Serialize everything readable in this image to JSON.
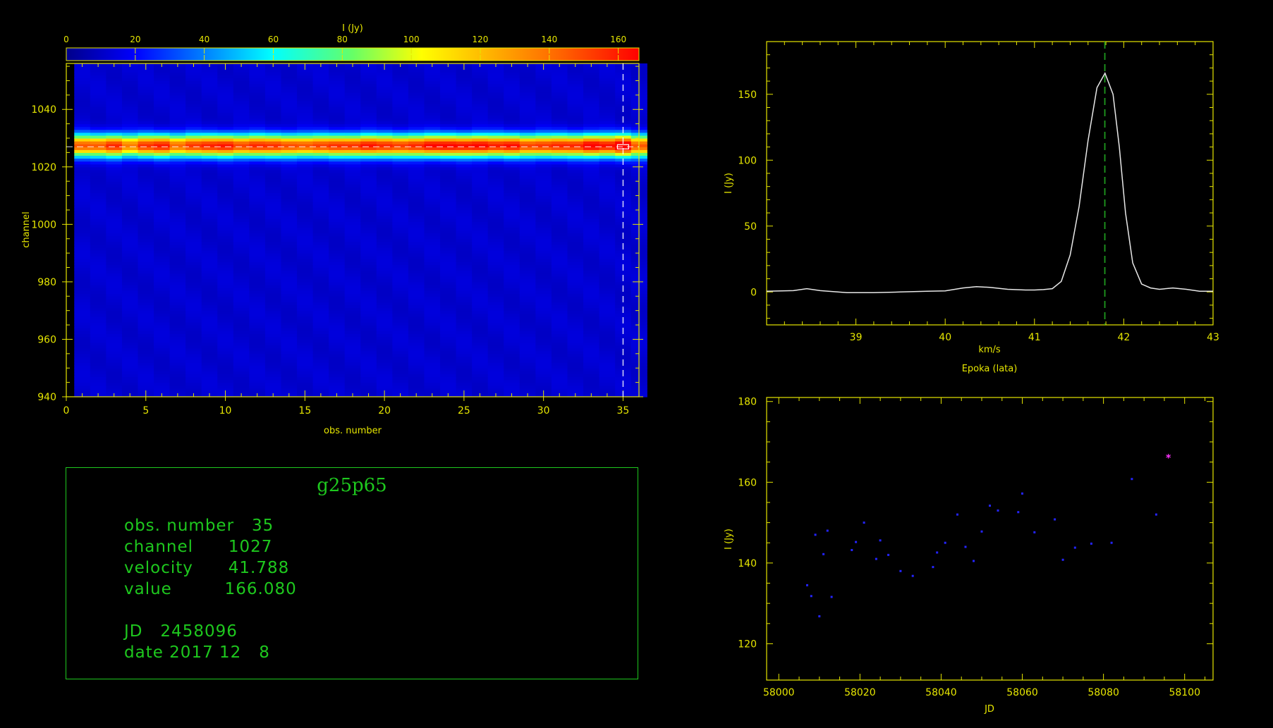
{
  "colors": {
    "axis": "#e6e600",
    "text": "#e6e600",
    "info": "#1ec81e",
    "spectrum": "#e8e8e8",
    "cursor_line": "#1e9a1e",
    "points": "#2424ff",
    "current_point": "#ff33ff",
    "background": "#000000"
  },
  "colorbar": {
    "label": "I (Jy)",
    "ticks": [
      "0",
      "20",
      "40",
      "60",
      "80",
      "100",
      "120",
      "140",
      "160"
    ],
    "range": [
      0,
      166
    ]
  },
  "waterfall": {
    "xlabel": "obs. number",
    "ylabel": "channel",
    "x_ticks": [
      "0",
      "5",
      "10",
      "15",
      "20",
      "25",
      "30",
      "35"
    ],
    "y_ticks": [
      "940",
      "960",
      "980",
      "1000",
      "1020",
      "1040"
    ],
    "xlim": [
      0,
      36
    ],
    "ylim": [
      940,
      1056
    ],
    "selected_obs": 35,
    "selected_channel": 1027,
    "n_obs": 36,
    "peak_channel": 1027
  },
  "info": {
    "title": "g25p65",
    "line1": "obs. number   35",
    "line2": "channel      1027",
    "line3": "velocity      41.788",
    "line4": "value         166.080",
    "line5": "JD   2458096",
    "line6": "date 2017 12   8"
  },
  "spectrum_chart": {
    "type": "line",
    "xlabel": "km/s",
    "ylabel": "I (Jy)",
    "footer": "Epoka (lata)",
    "x_ticks": [
      "39",
      "40",
      "41",
      "42",
      "43"
    ],
    "y_ticks": [
      "0",
      "50",
      "100",
      "150"
    ],
    "xlim": [
      38.0,
      43.0
    ],
    "ylim": [
      -25,
      190
    ],
    "cursor_velocity": 41.788,
    "points": [
      [
        38.0,
        0.5
      ],
      [
        38.3,
        1.0
      ],
      [
        38.45,
        2.5
      ],
      [
        38.6,
        1.0
      ],
      [
        38.9,
        -0.5
      ],
      [
        39.2,
        -0.5
      ],
      [
        39.5,
        0
      ],
      [
        39.8,
        0.5
      ],
      [
        40.0,
        0.8
      ],
      [
        40.2,
        3.0
      ],
      [
        40.35,
        4.0
      ],
      [
        40.5,
        3.5
      ],
      [
        40.7,
        2.0
      ],
      [
        40.9,
        1.5
      ],
      [
        41.0,
        1.5
      ],
      [
        41.1,
        1.8
      ],
      [
        41.2,
        2.5
      ],
      [
        41.3,
        8
      ],
      [
        41.4,
        28
      ],
      [
        41.5,
        65
      ],
      [
        41.6,
        115
      ],
      [
        41.7,
        155
      ],
      [
        41.79,
        166
      ],
      [
        41.88,
        150
      ],
      [
        41.95,
        110
      ],
      [
        42.02,
        60
      ],
      [
        42.1,
        22
      ],
      [
        42.2,
        6
      ],
      [
        42.3,
        3
      ],
      [
        42.4,
        2
      ],
      [
        42.55,
        3
      ],
      [
        42.7,
        2
      ],
      [
        42.85,
        0.5
      ],
      [
        43.0,
        0.5
      ]
    ]
  },
  "lightcurve_chart": {
    "type": "scatter",
    "xlabel": "JD",
    "ylabel": "I (Jy)",
    "x_ticks": [
      "58000",
      "58020",
      "58040",
      "58060",
      "58080",
      "58100"
    ],
    "y_ticks": [
      "120",
      "140",
      "160",
      "180"
    ],
    "xlim": [
      57997,
      58107
    ],
    "ylim": [
      111,
      181
    ],
    "points": [
      [
        58007,
        134.5
      ],
      [
        58008,
        131.8
      ],
      [
        58009,
        147.0
      ],
      [
        58010,
        126.8
      ],
      [
        58011,
        142.2
      ],
      [
        58012,
        148.0
      ],
      [
        58013,
        131.6
      ],
      [
        58018,
        143.2
      ],
      [
        58019,
        145.2
      ],
      [
        58021,
        150.0
      ],
      [
        58024,
        141.0
      ],
      [
        58025,
        145.6
      ],
      [
        58027,
        142.0
      ],
      [
        58030,
        138.0
      ],
      [
        58033,
        136.8
      ],
      [
        58038,
        139.0
      ],
      [
        58039,
        142.6
      ],
      [
        58041,
        145.0
      ],
      [
        58044,
        152.0
      ],
      [
        58046,
        144.0
      ],
      [
        58048,
        140.5
      ],
      [
        58050,
        147.8
      ],
      [
        58052,
        154.2
      ],
      [
        58054,
        153.0
      ],
      [
        58059,
        152.6
      ],
      [
        58060,
        157.2
      ],
      [
        58063,
        147.6
      ],
      [
        58068,
        150.8
      ],
      [
        58070,
        140.8
      ],
      [
        58073,
        143.8
      ],
      [
        58077,
        144.8
      ],
      [
        58082,
        145.0
      ],
      [
        58087,
        160.8
      ],
      [
        58093,
        152.0
      ]
    ],
    "current_point": [
      58096,
      166.08
    ]
  }
}
